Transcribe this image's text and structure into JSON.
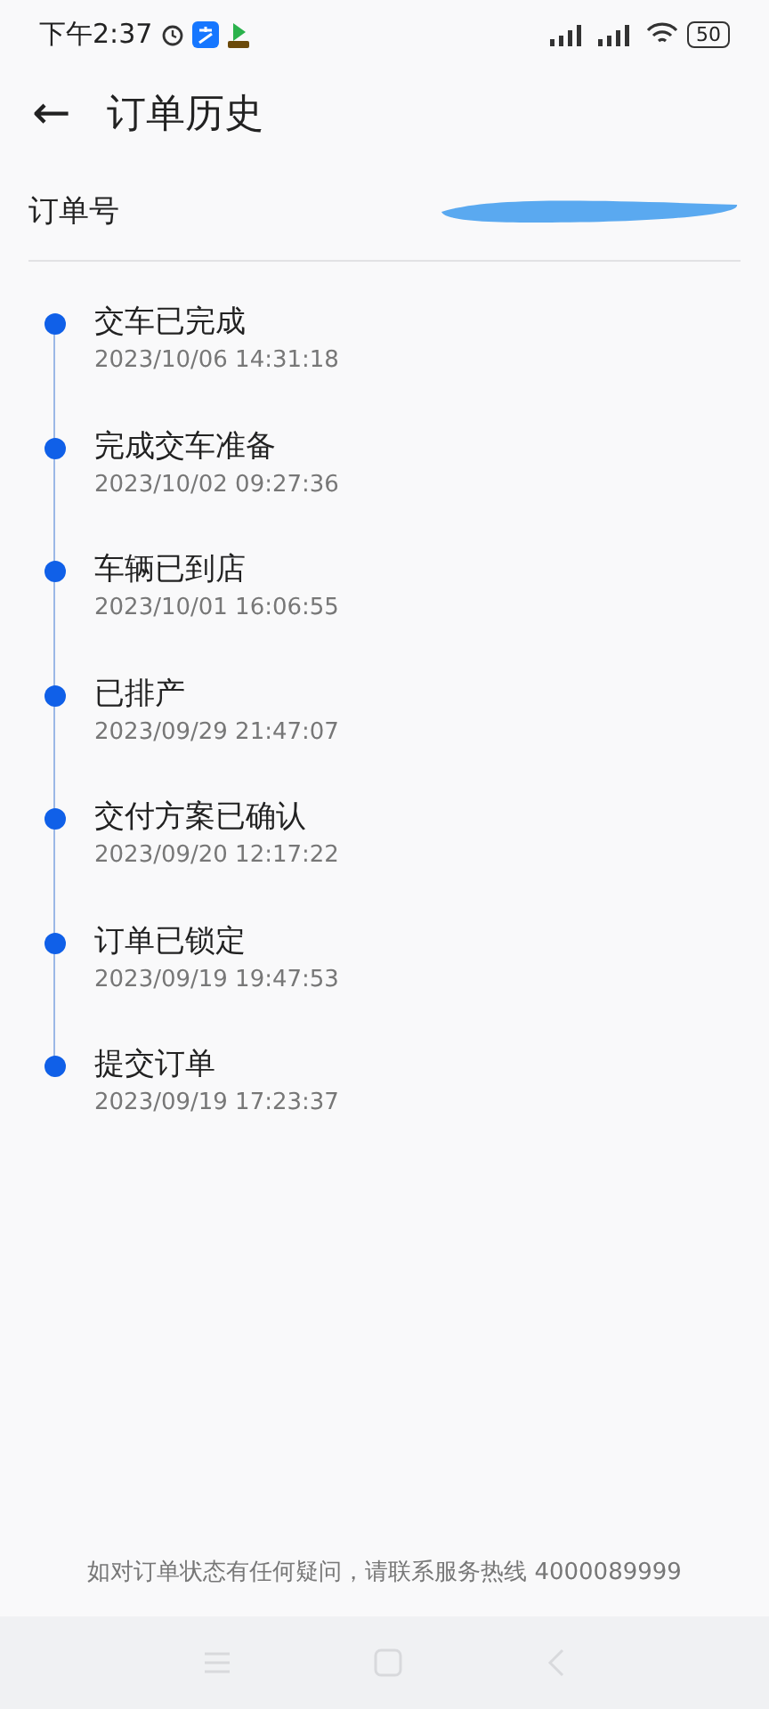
{
  "status_bar": {
    "time": "下午2:37",
    "battery": "50"
  },
  "header": {
    "back": "←",
    "title": "订单历史"
  },
  "order": {
    "label": "订单号"
  },
  "timeline": [
    {
      "title": "交车已完成",
      "time": "2023/10/06 14:31:18"
    },
    {
      "title": "完成交车准备",
      "time": "2023/10/02 09:27:36"
    },
    {
      "title": "车辆已到店",
      "time": "2023/10/01 16:06:55"
    },
    {
      "title": "已排产",
      "time": "2023/09/29 21:47:07"
    },
    {
      "title": "交付方案已确认",
      "time": "2023/09/20 12:17:22"
    },
    {
      "title": "订单已锁定",
      "time": "2023/09/19 19:47:53"
    },
    {
      "title": "提交订单",
      "time": "2023/09/19 17:23:37"
    }
  ],
  "footer": {
    "note": "如对订单状态有任何疑问，请联系服务热线 4000089999"
  }
}
